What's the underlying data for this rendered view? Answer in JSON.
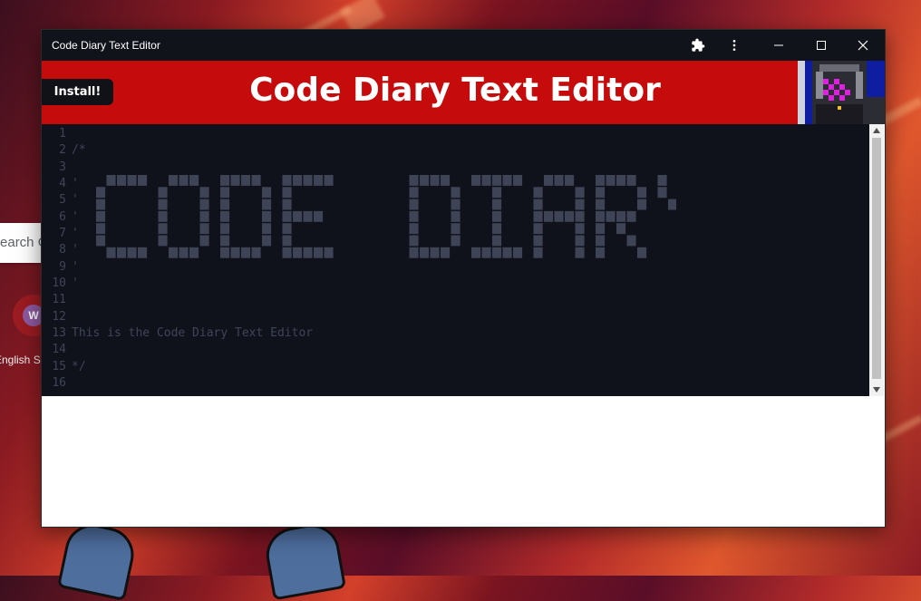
{
  "window": {
    "title": "Code Diary Text Editor",
    "icons": [
      "puzzle-icon",
      "more-vert-icon",
      "minimize-icon",
      "maximize-icon",
      "close-icon"
    ]
  },
  "header": {
    "heading": "Code Diary Text Editor",
    "install_label": "Install!"
  },
  "editor": {
    "lines": [
      {
        "num": "1",
        "text": ""
      },
      {
        "num": "2",
        "text": "/*"
      },
      {
        "num": "3",
        "text": ""
      },
      {
        "num": "4",
        "text": "'"
      },
      {
        "num": "5",
        "text": "'"
      },
      {
        "num": "6",
        "text": "'"
      },
      {
        "num": "7",
        "text": "'"
      },
      {
        "num": "8",
        "text": "'"
      },
      {
        "num": "9",
        "text": "'"
      },
      {
        "num": "10",
        "text": "'"
      },
      {
        "num": "11",
        "text": ""
      },
      {
        "num": "12",
        "text": ""
      },
      {
        "num": "13",
        "text": "This is the Code Diary Text Editor"
      },
      {
        "num": "14",
        "text": ""
      },
      {
        "num": "15",
        "text": "*/"
      },
      {
        "num": "16",
        "text": ""
      }
    ],
    "ascii_art_text": "CODE DIARY",
    "colors": {
      "background": "#10121b",
      "text": "#3f4557",
      "ascii": "#3e4356"
    }
  },
  "background": {
    "search_text": "Search Go",
    "avatar_letter": "W",
    "caption": "English S"
  },
  "colors": {
    "header": "#c50b0b",
    "titlebar": "#11131a",
    "install": "#111217"
  }
}
